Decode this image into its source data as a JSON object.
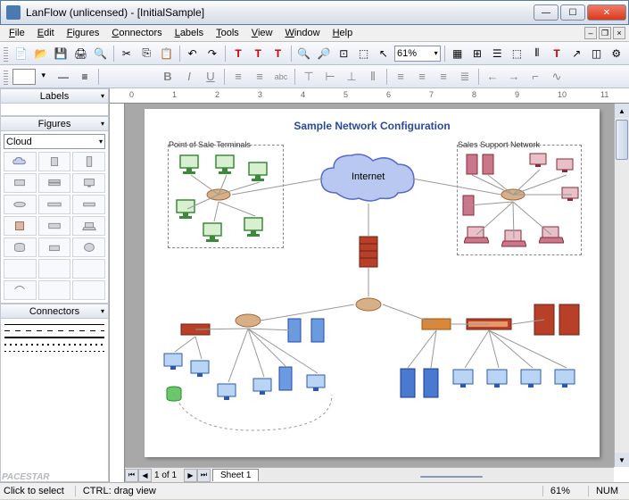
{
  "window": {
    "title": "LanFlow (unlicensed) - [InitialSample]",
    "min": "—",
    "max": "☐",
    "close": "✕"
  },
  "menu": [
    "File",
    "Edit",
    "Figures",
    "Connectors",
    "Labels",
    "Tools",
    "View",
    "Window",
    "Help"
  ],
  "toolbar": {
    "zoom": "61%"
  },
  "sidebar": {
    "labels_header": "Labels",
    "figures_header": "Figures",
    "figure_category": "Cloud",
    "connectors_header": "Connectors"
  },
  "canvas": {
    "title": "Sample Network Configuration",
    "group_pos": "Point of Sale Terminals",
    "group_sales": "Sales Support Network",
    "cloud_label": "Internet",
    "sheet_tab": "Sheet 1",
    "page_indicator": "1 of 1",
    "ruler_marks": [
      "0",
      "1",
      "2",
      "3",
      "4",
      "5",
      "6",
      "7",
      "8",
      "9",
      "10",
      "11"
    ]
  },
  "status": {
    "hint": "Click to select",
    "hint2": "CTRL: drag view",
    "zoom": "61%",
    "num": "NUM"
  },
  "brand": "PACESTAR"
}
